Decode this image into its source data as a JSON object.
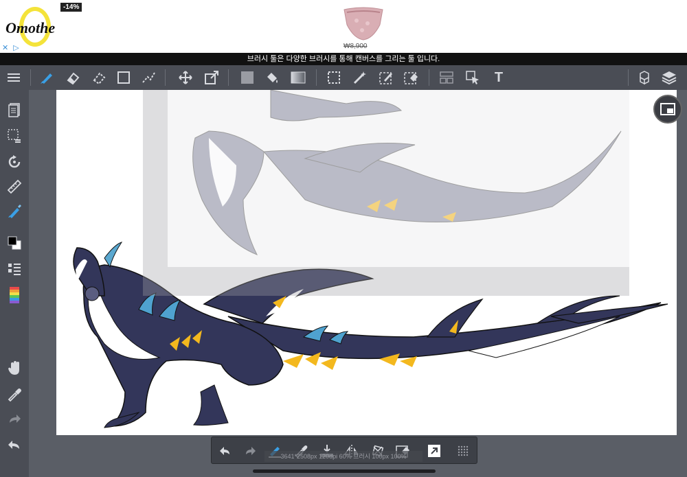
{
  "ad": {
    "brand": "Omothe",
    "discount": "-14%",
    "price": "₩8,900",
    "adchoice": "✕ ▷"
  },
  "tooltip": "브러시 툴은 다양한 브러시를 통해 캔버스를 그리는 툴 입니다.",
  "status_text": "3641*2508px 120dpi 60% 브러시 100px 100%",
  "icons": {
    "menu": "menu-icon",
    "brush": "brush-icon",
    "eraser": "eraser-icon",
    "soft_eraser": "blur-eraser-icon",
    "rect": "rectangle-icon",
    "select_pen": "select-pen-icon",
    "move": "move-icon",
    "transform": "transform-icon",
    "fill_color": "fill-icon",
    "bucket": "bucket-icon",
    "gradient": "gradient-icon",
    "marquee": "marquee-icon",
    "magic_wand": "magic-wand-icon",
    "select_draw": "select-draw-icon",
    "select_erase": "select-erase-icon",
    "frame": "frame-icon",
    "pointer": "pointer-icon",
    "text": "T",
    "materials": "materials-icon",
    "layers": "layers-icon"
  },
  "colors": {
    "accent": "#3aa0e6",
    "toolbar": "#4a4d55",
    "canvas": "#ffffff"
  }
}
